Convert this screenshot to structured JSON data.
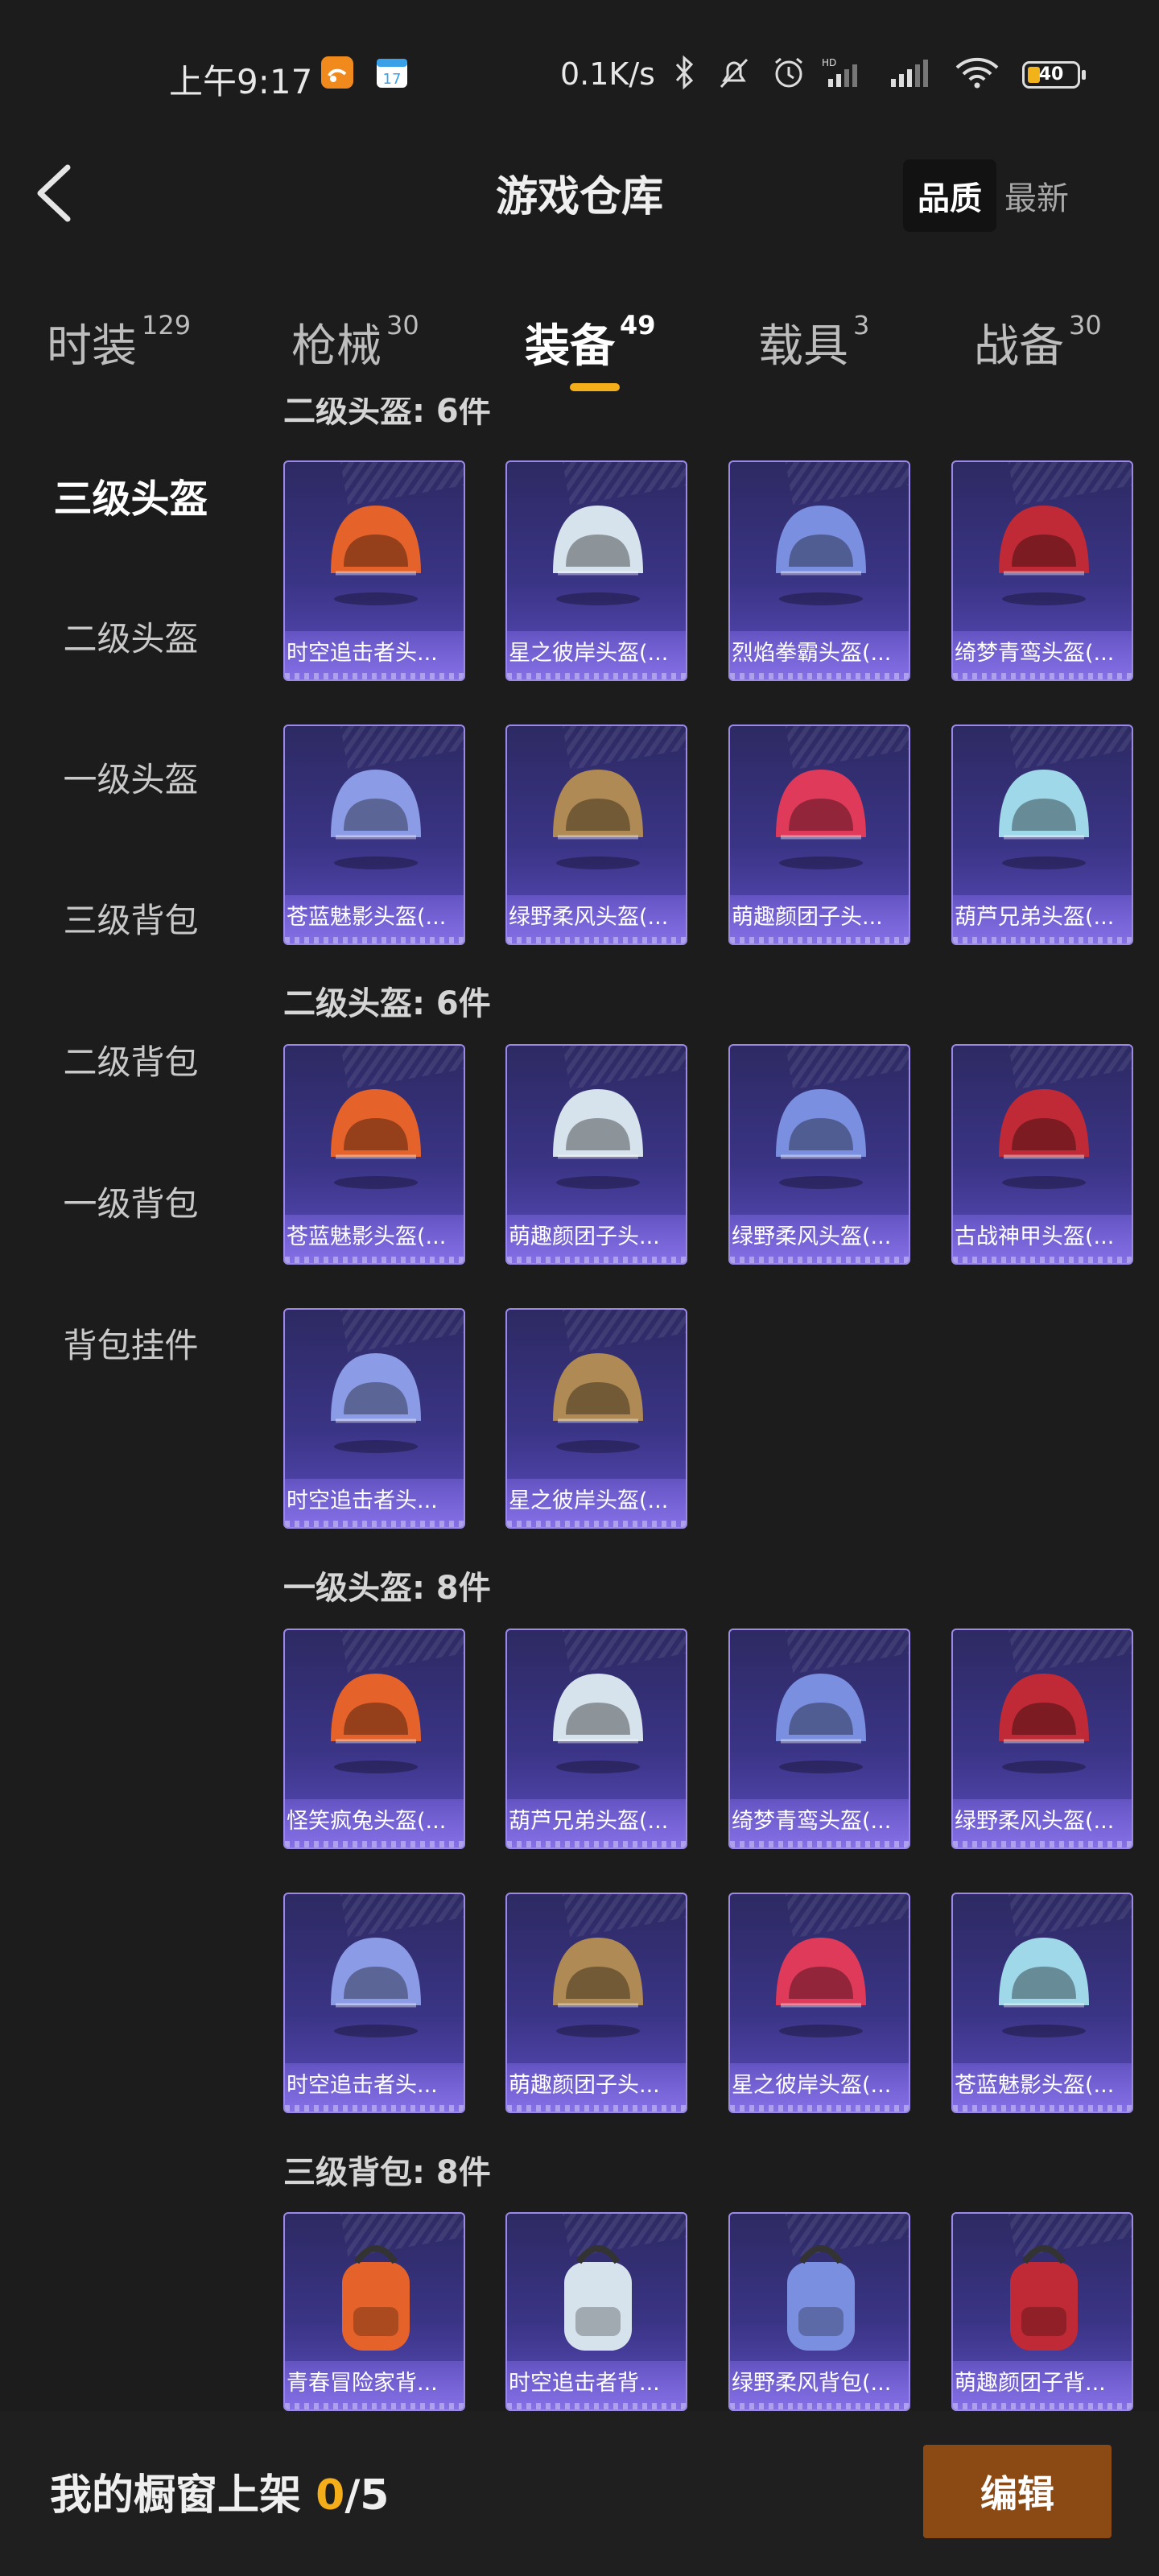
{
  "status_bar": {
    "time": "上午9:17",
    "speed": "0.1K/s",
    "battery": "40",
    "icons": [
      "uc-browser-icon",
      "calendar-icon",
      "bluetooth-icon",
      "mute-bell-icon",
      "alarm-icon",
      "hd-signal-icon",
      "signal-icon",
      "wifi-icon",
      "battery-icon"
    ],
    "calendar_day": "17"
  },
  "header": {
    "title": "游戏仓库",
    "sort_quality": "品质",
    "sort_newest": "最新"
  },
  "tabs": [
    {
      "label": "时装",
      "count": "129"
    },
    {
      "label": "枪械",
      "count": "30"
    },
    {
      "label": "装备",
      "count": "49"
    },
    {
      "label": "载具",
      "count": "3"
    },
    {
      "label": "战备",
      "count": "30"
    }
  ],
  "active_tab": "装备",
  "sidebar": [
    {
      "label": "三级头盔"
    },
    {
      "label": "二级头盔"
    },
    {
      "label": "一级头盔"
    },
    {
      "label": "三级背包"
    },
    {
      "label": "二级背包"
    },
    {
      "label": "一级背包"
    },
    {
      "label": "背包挂件"
    }
  ],
  "sections": {
    "top_partial": "二级头盔: 6件",
    "helmet2": "二级头盔: 6件",
    "helmet1": "一级头盔: 8件",
    "bag3": "三级背包: 8件"
  },
  "items": {
    "h3": [
      "时空追击者头...",
      "星之彼岸头盔(...",
      "烈焰拳霸头盔(...",
      "绮梦青鸾头盔(...",
      "苍蓝魅影头盔(...",
      "绿野柔风头盔(...",
      "萌趣颜团子头...",
      "葫芦兄弟头盔(..."
    ],
    "h2": [
      "苍蓝魅影头盔(...",
      "萌趣颜团子头...",
      "绿野柔风头盔(...",
      "古战神甲头盔(...",
      "时空追击者头...",
      "星之彼岸头盔(..."
    ],
    "h1": [
      "怪笑疯兔头盔(...",
      "葫芦兄弟头盔(...",
      "绮梦青鸾头盔(...",
      "绿野柔风头盔(...",
      "时空追击者头...",
      "萌趣颜团子头...",
      "星之彼岸头盔(...",
      "苍蓝魅影头盔(..."
    ],
    "b3": [
      "青春冒险家背...",
      "时空追击者背...",
      "绿野柔风背包(...",
      "萌趣颜团子背..."
    ]
  },
  "colors": {
    "accent": "#f4ae19",
    "card_border": "#9c88e6",
    "edit_button": "#8b4a14",
    "background": "#1c1c1d"
  },
  "bottom_bar": {
    "label": "我的橱窗上架",
    "current": "0",
    "total": "/5",
    "edit_label": "编辑"
  }
}
